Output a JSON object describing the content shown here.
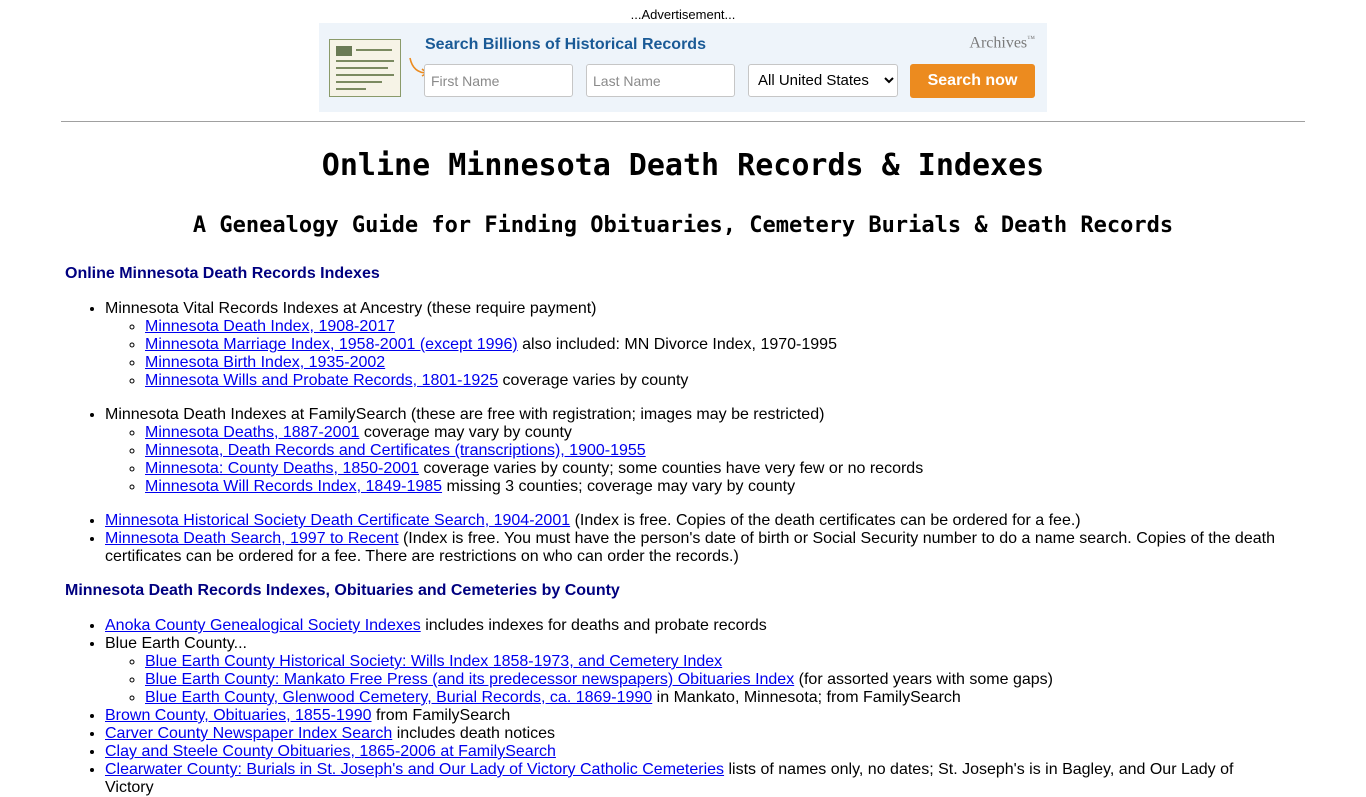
{
  "ad": {
    "label": "...Advertisement...",
    "headline": "Search Billions of Historical Records",
    "brand": "Archives",
    "brand_mark": "™",
    "first_name_placeholder": "First Name",
    "last_name_placeholder": "Last Name",
    "location_selected": "All United States",
    "search_button": "Search now",
    "colors": {
      "headline": "#1a5a96",
      "button": "#ec8b1f",
      "panel": "#eef4fa"
    }
  },
  "page": {
    "title": "Online Minnesota Death Records & Indexes",
    "subtitle": "A Genealogy Guide for Finding Obituaries, Cemetery Burials & Death Records"
  },
  "sections": {
    "statewide": {
      "heading": "Online Minnesota Death Records Indexes",
      "ancestry_text": "Minnesota Vital Records Indexes at Ancestry (these require payment)",
      "ancestry_links": [
        {
          "link": "Minnesota Death Index, 1908-2017",
          "note": ""
        },
        {
          "link": "Minnesota Marriage Index, 1958-2001 (except 1996)",
          "note": " also included: MN Divorce Index, 1970-1995"
        },
        {
          "link": "Minnesota Birth Index, 1935-2002",
          "note": ""
        },
        {
          "link": "Minnesota Wills and Probate Records, 1801-1925",
          "note": " coverage varies by county"
        }
      ],
      "familysearch_text": "Minnesota Death Indexes at FamilySearch (these are free with registration; images may be restricted)",
      "familysearch_links": [
        {
          "link": "Minnesota Deaths, 1887-2001",
          "note": " coverage may vary by county"
        },
        {
          "link": "Minnesota, Death Records and Certificates (transcriptions), 1900-1955",
          "note": ""
        },
        {
          "link": "Minnesota: County Deaths, 1850-2001",
          "note": " coverage varies by county; some counties have very few or no records"
        },
        {
          "link": "Minnesota Will Records Index, 1849-1985",
          "note": " missing 3 counties; coverage may vary by county"
        }
      ],
      "mhs": {
        "link": "Minnesota Historical Society Death Certificate Search, 1904-2001",
        "note": " (Index is free. Copies of the death certificates can be ordered for a fee.)"
      },
      "death_search": {
        "link": "Minnesota Death Search, 1997 to Recent",
        "note": " (Index is free. You must have the person's date of birth or Social Security number to do a name search. Copies of the death certificates can be ordered for a fee. There are restrictions on who can order the records.)"
      }
    },
    "county": {
      "heading": "Minnesota Death Records Indexes, Obituaries and Cemeteries by County",
      "anoka": {
        "link": "Anoka County Genealogical Society Indexes",
        "note": " includes indexes for deaths and probate records"
      },
      "blue_earth_text": "Blue Earth County...",
      "blue_earth_links": [
        {
          "link": "Blue Earth County Historical Society: Wills Index 1858-1973, and Cemetery Index",
          "note": ""
        },
        {
          "link": "Blue Earth County: Mankato Free Press (and its predecessor newspapers) Obituaries Index",
          "note": " (for assorted years with some gaps)"
        },
        {
          "link": "Blue Earth County, Glenwood Cemetery, Burial Records, ca. 1869-1990",
          "note": " in Mankato, Minnesota; from FamilySearch"
        }
      ],
      "brown": {
        "link": "Brown County, Obituaries, 1855-1990",
        "note": " from FamilySearch"
      },
      "carver": {
        "link": "Carver County Newspaper Index Search",
        "note": " includes death notices"
      },
      "clay": {
        "link": "Clay and Steele County Obituaries, 1865-2006 at FamilySearch",
        "note": ""
      },
      "clearwater": {
        "link": "Clearwater County: Burials in St. Joseph's and Our Lady of Victory Catholic Cemeteries",
        "note": " lists of names only, no dates; St. Joseph's is in Bagley, and Our Lady of Victory"
      }
    }
  }
}
